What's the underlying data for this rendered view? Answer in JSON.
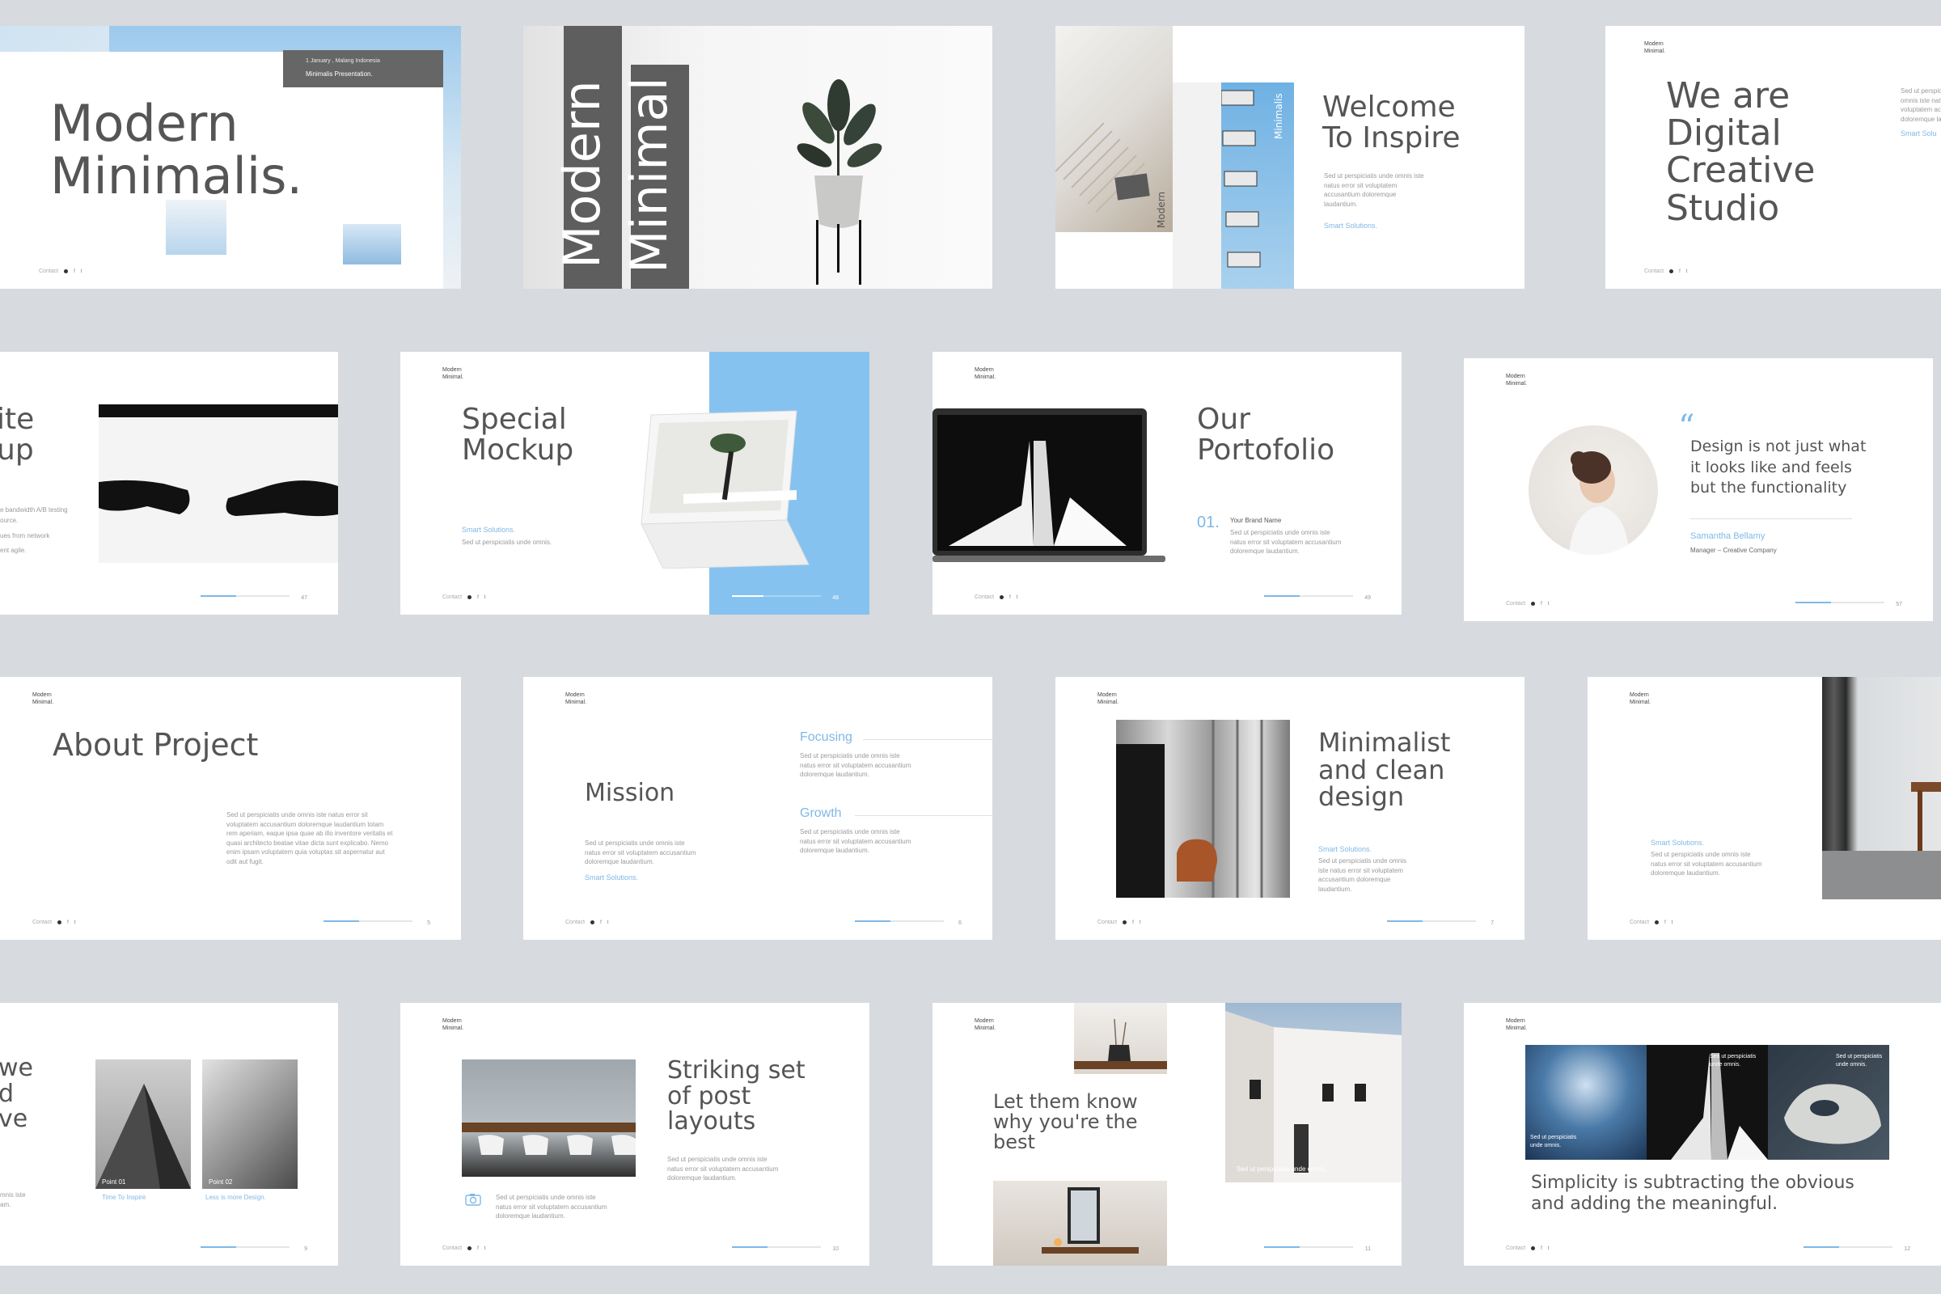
{
  "colors": {
    "background": "#d7dade",
    "accent": "#7fb8e6",
    "text": "#555555",
    "dark_block": "#5e5e5e"
  },
  "brand": "Modern\nMinimal.",
  "footer": {
    "contact": "Contact",
    "icons": [
      "dot-icon",
      "facebook-icon",
      "twitter-icon"
    ],
    "f": "f",
    "t": "t"
  },
  "lorem": {
    "short": "Sed ut perspiciatis unde omnis iste natus error sit voluptatem accusantium doloremque laudantium.",
    "long": "Sed ut perspiciatis unde omnis iste natus error sit voluptatem accusantium doloremque laudantium totam rem aperiam, eaque ipsa quae ab illo inventore veritatis et quasi architecto beatae vitae dicta sunt explicabo. Nemo enim ipsam voluptatem quia voluptas sit aspernatur aut odit aut fugit.",
    "mini": "Sed ut perspiciatis unde omnis."
  },
  "slides": {
    "s1": {
      "title": "Modern\nMinimalis.",
      "box_line1": "1 January , Malang Indonesia",
      "box_line2": "Minimalis Presentation."
    },
    "s2": {
      "word1": "Modern",
      "word2": "Minimal"
    },
    "s3": {
      "title": "Welcome\nTo Inspire",
      "accent": "Smart Solutions.",
      "vert1": "Minimalis",
      "vert2": "Modern"
    },
    "s4": {
      "title": "We are\nDigital\nCreative\nStudio",
      "accent": "Smart Solu"
    },
    "s5": {
      "title_frag": "ite\nup",
      "lines": [
        "e bandwidth A/B testing",
        "ource.",
        "ues from network",
        "ent agile."
      ],
      "page": "47"
    },
    "s6": {
      "title": "Special\nMockup",
      "accent": "Smart Solutions.",
      "page": "48"
    },
    "s7": {
      "title": "Our\nPortofolio",
      "num": "01.",
      "brand_name": "Your Brand Name",
      "page": "49"
    },
    "s8": {
      "quote_mark": "“",
      "quote": "Design is not just what\nit looks like and feels\nbut the functionality",
      "author": "Samantha Bellamy",
      "role": "Manager – Creative Company",
      "page": "57"
    },
    "s9": {
      "title": "About Project",
      "page": "5"
    },
    "s10": {
      "title": "Mission",
      "accent": "Smart Solutions.",
      "focus": "Focusing",
      "growth": "Growth",
      "page": "6"
    },
    "s11": {
      "title": "Minimalist\nand clean\ndesign",
      "accent": "Smart Solutions.",
      "page": "7"
    },
    "s12": {
      "accent": "Smart Solutions."
    },
    "s13": {
      "title_frag": "we\nd\nve",
      "point1": "Point 01",
      "point2": "Point 02",
      "cap1": "Time To Inspire",
      "cap2": "Less is more Design.",
      "small_frag": "mnis iste\nam.",
      "page": "9"
    },
    "s14": {
      "title": "Striking set\nof post\nlayouts",
      "page": "10"
    },
    "s15": {
      "title": "Let them know\nwhy you're the\nbest",
      "caption": "Sed ut perspiciatis unde omnis.",
      "page": "11"
    },
    "s16": {
      "quote": "Simplicity is subtracting the obvious\nand adding the meaningful.",
      "cap1": "Sed ut perspiciatis\nunde omnis.",
      "cap2": "Sed ut perspiciatis\nunde omnis.",
      "cap3": "Sed ut perspiciatis\nunde omnis.",
      "page": "12"
    }
  }
}
